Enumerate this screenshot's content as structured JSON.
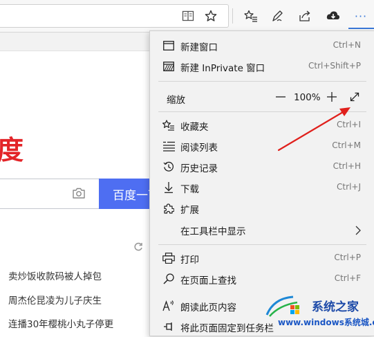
{
  "toolbar": {
    "icons": [
      "reading-view-icon",
      "favorite-star-icon",
      "favorites-list-icon",
      "pen-icon",
      "share-icon",
      "download-icon",
      "more-icon"
    ],
    "more_label": "···"
  },
  "background_page": {
    "logo_fragment": "度",
    "search_button": "百度一下",
    "news": [
      "卖炒饭收款码被人掉包",
      "周杰伦昆凌为儿子庆生",
      "连播30年樱桃小丸子停更"
    ]
  },
  "menu": {
    "new_window": {
      "label": "新建窗口",
      "shortcut": "Ctrl+N"
    },
    "new_private": {
      "label": "新建 InPrivate 窗口",
      "shortcut": "Ctrl+Shift+P"
    },
    "zoom": {
      "label": "缩放",
      "minus": "—",
      "value": "100%",
      "plus": "+"
    },
    "favorites": {
      "label": "收藏夹",
      "shortcut": "Ctrl+I"
    },
    "reading_list": {
      "label": "阅读列表",
      "shortcut": "Ctrl+M"
    },
    "history": {
      "label": "历史记录",
      "shortcut": "Ctrl+H"
    },
    "downloads": {
      "label": "下载",
      "shortcut": "Ctrl+J"
    },
    "extensions": {
      "label": "扩展"
    },
    "show_in_toolbar": {
      "label": "在工具栏中显示"
    },
    "print": {
      "label": "打印",
      "shortcut": "Ctrl+P"
    },
    "find": {
      "label": "在页面上查找",
      "shortcut": "Ctrl+F"
    },
    "read_aloud": {
      "label": "朗读此页内容"
    },
    "pin_taskbar": {
      "label": "将此页面固定到任务栏"
    }
  },
  "watermark": {
    "top_text": "系统之家",
    "site": "www.windows系统城.com"
  },
  "colors": {
    "accent": "#3a78d8",
    "annotation_arrow": "#e0201c",
    "baidu_red": "#e32529",
    "baidu_blue": "#4e6ef2"
  }
}
